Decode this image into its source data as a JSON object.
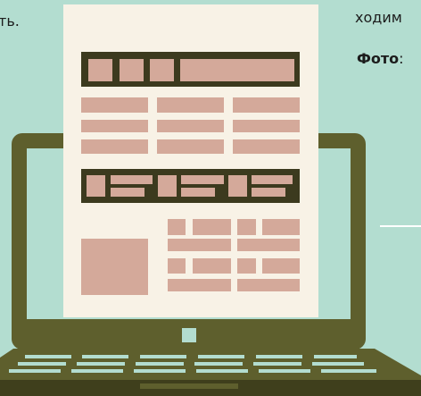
{
  "text": {
    "left_fragment": "ть.",
    "right_fragment": "ходим",
    "photo_label": "Фото",
    "photo_colon": ":"
  },
  "colors": {
    "background": "#b3ddd0",
    "laptop_frame": "#5e5f2d",
    "laptop_dark": "#3f3f1c",
    "screen_fill": "#b3ddd0",
    "paper": "#f8f2e6",
    "block_dark": "#3c3a1e",
    "block_pink": "#d4a99a",
    "accent_line": "#ffffff"
  },
  "icons": {
    "illustration": "laptop-with-document-illustration"
  }
}
